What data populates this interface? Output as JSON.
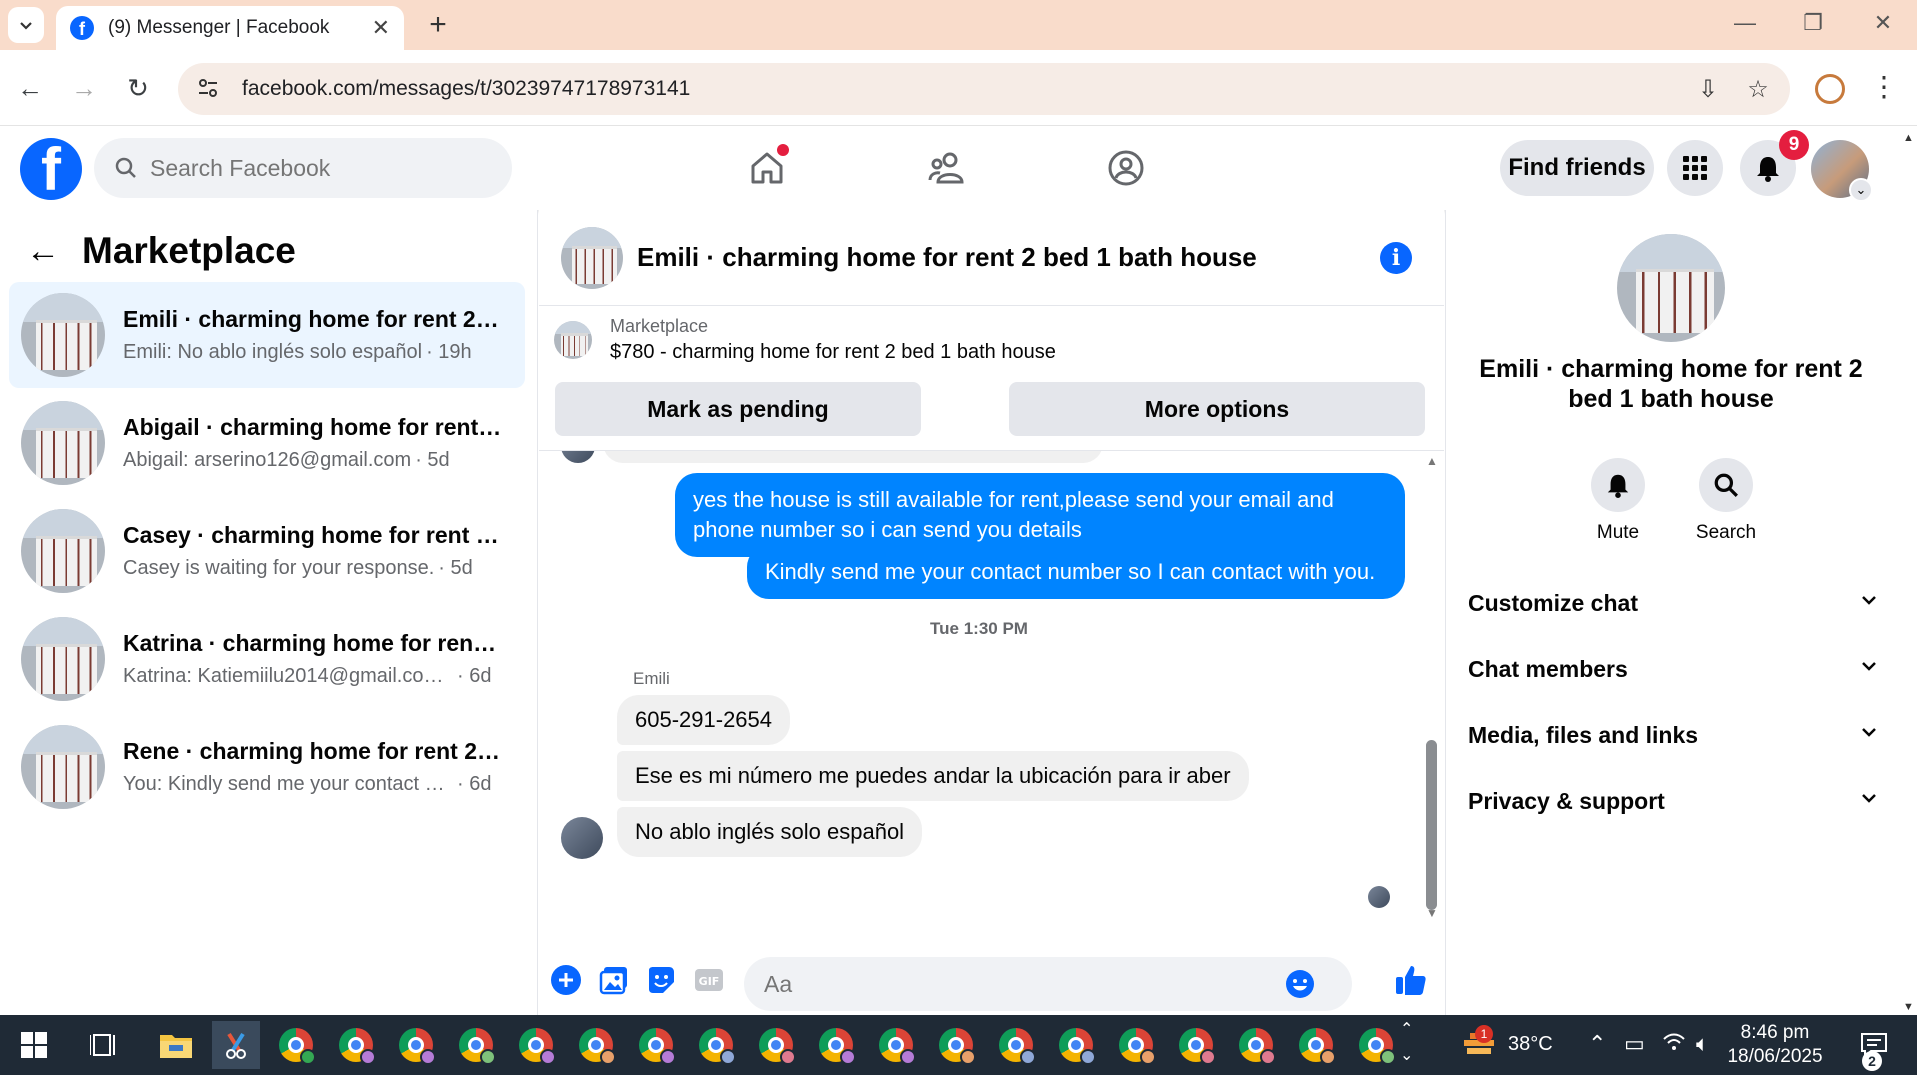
{
  "browser": {
    "tab_title": "(9) Messenger | Facebook",
    "url": "facebook.com/messages/t/30239747178973141"
  },
  "fb": {
    "search_placeholder": "Search Facebook",
    "find_friends": "Find friends",
    "notification_count": "9"
  },
  "left": {
    "title": "Marketplace",
    "conversations": [
      {
        "name": "Emili · charming home for rent 2 b...",
        "preview": "Emili: No ablo inglés solo español",
        "time": "· 19h"
      },
      {
        "name": "Abigail · charming home for rent 2...",
        "preview": "Abigail: arserino126@gmail.com",
        "time": "· 5d"
      },
      {
        "name": "Casey · charming home for rent 2 ...",
        "preview": "Casey is waiting for your response.",
        "time": "· 5d"
      },
      {
        "name": "Katrina · charming home for rent 2...",
        "preview": "Katrina: Katiemiilu2014@gmail.com 9...",
        "time": "· 6d"
      },
      {
        "name": "Rene · charming home for rent 2 b...",
        "preview": "You: Kindly send me your contact nu...",
        "time": "· 6d"
      }
    ]
  },
  "chat": {
    "title": "Emili · charming home for rent 2 bed 1 bath house",
    "listing_label": "Marketplace",
    "listing_price_title": "$780 - charming home for rent 2 bed 1 bath house",
    "mark_pending": "Mark as pending",
    "more_options": "More options",
    "messages_out": [
      "yes the house is still available for rent,please send your email and phone number so i can send you details",
      "Kindly send me your contact number so I can contact with you."
    ],
    "timestamp": "Tue 1:30 PM",
    "sender_name": "Emili",
    "messages_in": [
      "605-291-2654",
      "Ese es mi número    me puedes andar la ubicación  para ir aber",
      "No ablo inglés  solo español"
    ],
    "composer_placeholder": "Aa"
  },
  "right": {
    "name": "Emili · charming home for rent 2 bed 1 bath house",
    "mute": "Mute",
    "search": "Search",
    "sections": [
      "Customize chat",
      "Chat members",
      "Media, files and links",
      "Privacy & support"
    ]
  },
  "taskbar": {
    "temperature": "38°C",
    "time": "8:46 pm",
    "date": "18/06/2025",
    "weather_badge": "1",
    "notification_count": "2"
  },
  "colors": {
    "fb_blue": "#0866ff",
    "messenger_blue": "#0084ff",
    "tabstrip": "#f9dccb",
    "taskbar": "#1f2a36"
  }
}
